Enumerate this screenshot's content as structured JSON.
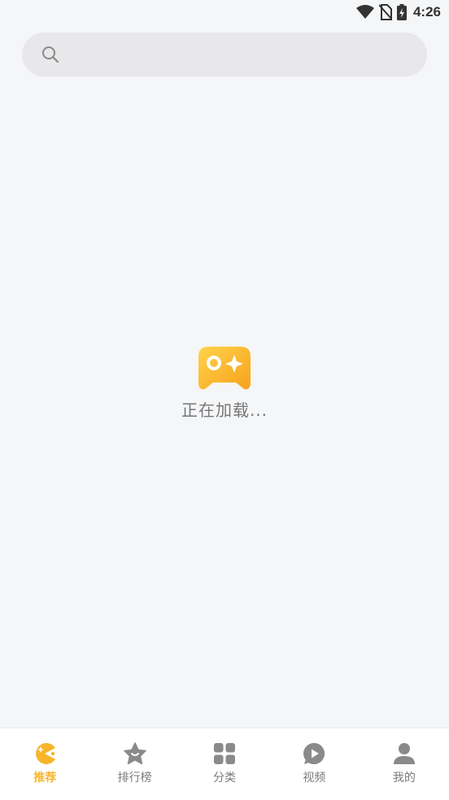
{
  "status_bar": {
    "time": "4:26",
    "icons": [
      "wifi-icon",
      "no-sim-icon",
      "battery-charging-icon"
    ]
  },
  "search": {
    "placeholder": "",
    "icon": "search-icon"
  },
  "loading": {
    "icon": "gamepad-icon",
    "text": "正在加载..."
  },
  "tabs": [
    {
      "label": "推荐",
      "icon": "pacman-icon",
      "active": true
    },
    {
      "label": "排行榜",
      "icon": "star-icon",
      "active": false
    },
    {
      "label": "分类",
      "icon": "grid-icon",
      "active": false
    },
    {
      "label": "视频",
      "icon": "play-circle-icon",
      "active": false
    },
    {
      "label": "我的",
      "icon": "user-icon",
      "active": false
    }
  ],
  "colors": {
    "accent": "#f7b52c",
    "background": "#f5f6f8",
    "inactive": "#7a7a7a"
  }
}
